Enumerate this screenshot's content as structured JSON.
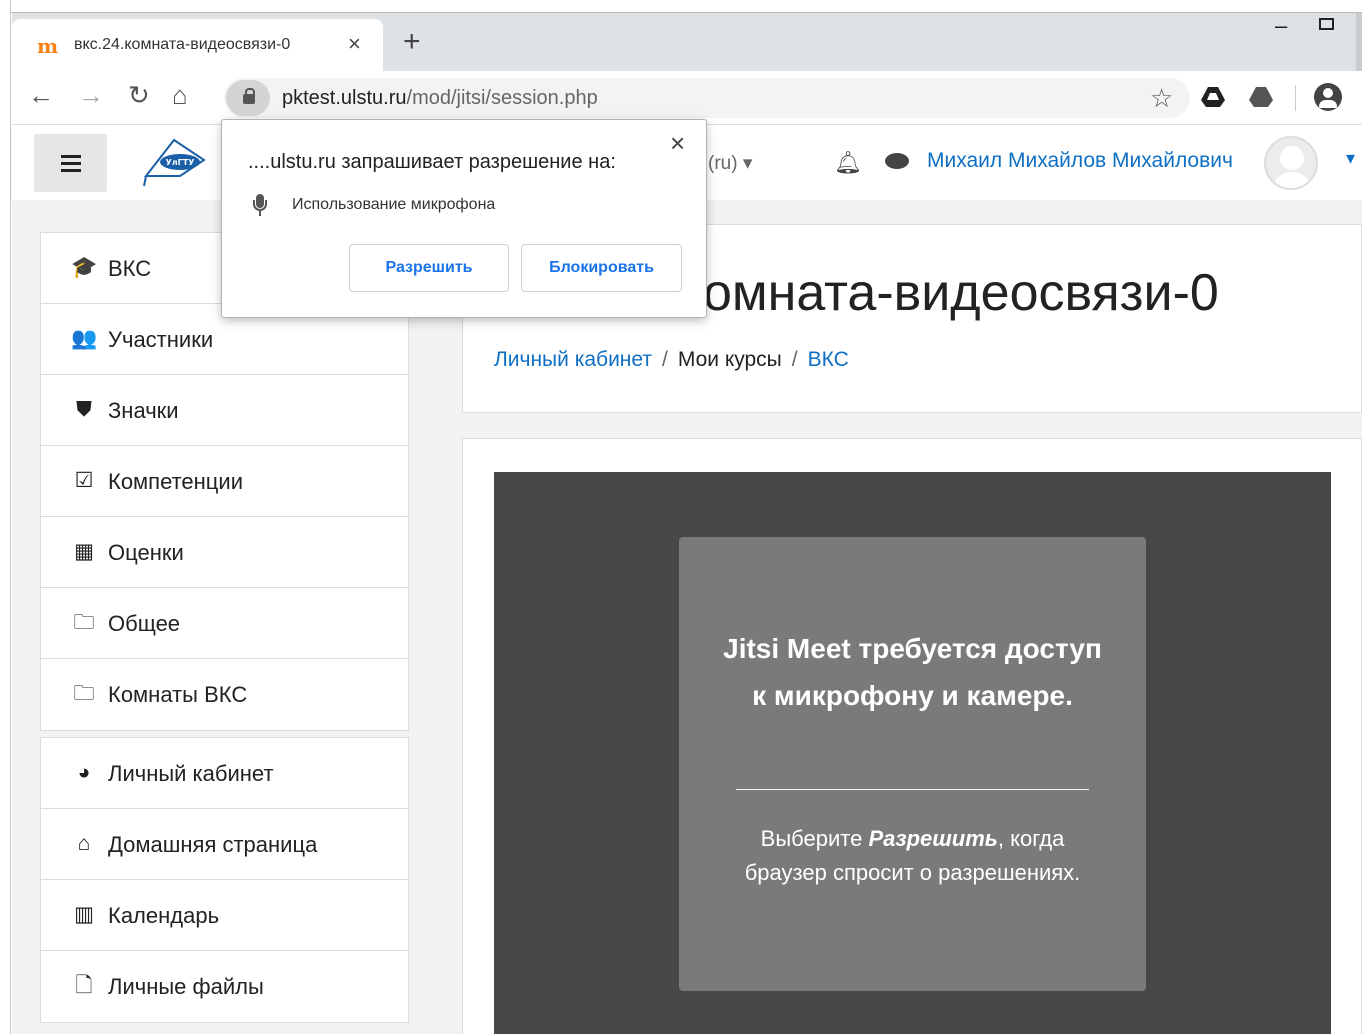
{
  "browser": {
    "tab_title": "вкс.24.комната-видеосвязи-0",
    "tab_favicon": "m",
    "tab_close": "×",
    "new_tab": "+",
    "url_host": "pktest.ulstu.ru",
    "url_path": "/mod/jitsi/session.php",
    "nav_icons": {
      "back": "←",
      "forward": "→",
      "reload": "↻",
      "home": "⌂",
      "bookmark": "☆"
    }
  },
  "permission_popup": {
    "title": "....ulstu.ru запрашивает разрешение на:",
    "item": "Использование микрофона",
    "allow_label": "Разрешить",
    "block_label": "Блокировать",
    "close": "×"
  },
  "navbar": {
    "lang": "(ru)",
    "lang_caret": "▾",
    "user_name": "Михаил Михайлов Михайлович",
    "user_caret": "▾"
  },
  "sidebar": {
    "items": [
      {
        "label": "ВКС",
        "icon": "graduation-cap-icon",
        "glyph": "🎓"
      },
      {
        "label": "Участники",
        "icon": "users-icon",
        "glyph": "👥"
      },
      {
        "label": "Значки",
        "icon": "shield-icon",
        "glyph": "⛊"
      },
      {
        "label": "Компетенции",
        "icon": "check-square-icon",
        "glyph": "☑"
      },
      {
        "label": "Оценки",
        "icon": "table-icon",
        "glyph": "▦"
      },
      {
        "label": "Общее",
        "icon": "folder-icon",
        "glyph": "🗀"
      },
      {
        "label": "Комнаты ВКС",
        "icon": "folder-icon",
        "glyph": "🗀"
      }
    ],
    "items2": [
      {
        "label": "Личный кабинет",
        "icon": "dashboard-icon",
        "glyph": "◕"
      },
      {
        "label": "Домашняя страница",
        "icon": "home-icon",
        "glyph": "⌂"
      },
      {
        "label": "Календарь",
        "icon": "calendar-icon",
        "glyph": "▥"
      },
      {
        "label": "Личные файлы",
        "icon": "file-icon",
        "glyph": "🗋"
      }
    ]
  },
  "main": {
    "page_title": "омната-видеосвязи-0",
    "breadcrumb": {
      "item1": "Личный кабинет",
      "item2": "Мои курсы",
      "item3": "ВКС",
      "sep": "/"
    }
  },
  "jitsi": {
    "heading": "Jitsi Meet требуется доступ к микрофону и камере.",
    "body_prefix": "Выберите ",
    "body_em": "Разрешить",
    "body_suffix": ", когда браузер спросит о разрешениях."
  },
  "colors": {
    "link": "#0f6fc5",
    "jitsi_bg": "#474747",
    "jitsi_box": "#7a7a7a",
    "chrome_blue": "#1a73e8"
  }
}
